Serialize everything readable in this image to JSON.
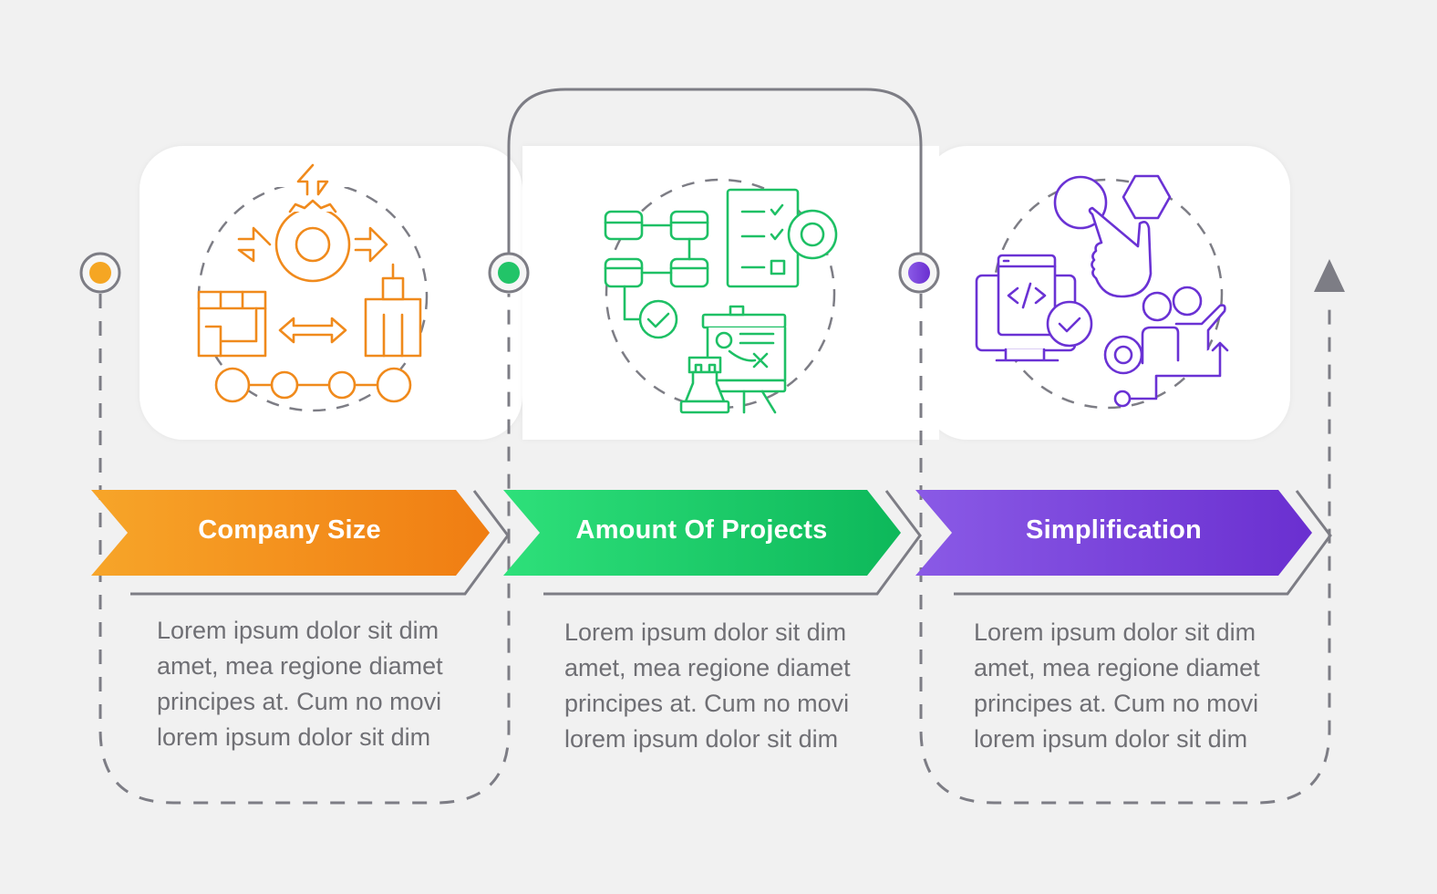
{
  "infographic": {
    "colors": {
      "background": "#f1f1f1",
      "panel": "#ffffff",
      "line": "#7d7d85",
      "text": "#6f6f74"
    },
    "steps": [
      {
        "title": "Company Size",
        "icon": "company-size-icon",
        "accent_start": "#f7a529",
        "accent_end": "#f07d12",
        "dot": "#f5a623",
        "description": "Lorem ipsum dolor sit dim\namet, mea regione diamet\nprincipes at. Cum no movi\nlorem ipsum dolor sit dim"
      },
      {
        "title": "Amount Of Projects",
        "icon": "project-management-icon",
        "accent_start": "#2ee07a",
        "accent_end": "#0db85a",
        "dot": "#22c468",
        "description": "Lorem ipsum dolor sit dim\namet, mea regione diamet\nprincipes at. Cum no movi\nlorem ipsum dolor sit dim"
      },
      {
        "title": "Simplification",
        "icon": "simplification-icon",
        "accent_start": "#8a5ae6",
        "accent_end": "#6a2fd0",
        "dot": "#7b3fe0",
        "description": "Lorem ipsum dolor sit dim\namet, mea regione diamet\nprincipes at. Cum no movi\nlorem ipsum dolor sit dim"
      }
    ]
  }
}
